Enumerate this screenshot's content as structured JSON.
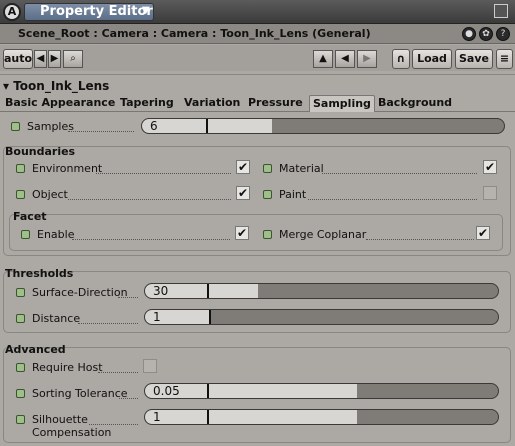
{
  "window": {
    "logo": "A",
    "title": "Property Editor",
    "dropdown_glyph": "▼"
  },
  "pathbar": {
    "path": "Scene_Root : Camera : Camera : Toon_Ink_Lens (General)"
  },
  "toolbar": {
    "auto_label": "auto",
    "load_label": "Load",
    "save_label": "Save"
  },
  "property": {
    "name": "Toon_Ink_Lens"
  },
  "tabs": [
    {
      "label": "Basic Appearance",
      "active": false
    },
    {
      "label": "Tapering",
      "active": false
    },
    {
      "label": "Variation",
      "active": false
    },
    {
      "label": "Pressure",
      "active": false
    },
    {
      "label": "Sampling",
      "active": true
    },
    {
      "label": "Background",
      "active": false
    }
  ],
  "samples": {
    "label": "Samples",
    "value": "6",
    "level": 0.36
  },
  "boundaries": {
    "title": "Boundaries",
    "environment": {
      "label": "Environment",
      "checked": true
    },
    "material": {
      "label": "Material",
      "checked": true
    },
    "object": {
      "label": "Object",
      "checked": true
    },
    "paint": {
      "label": "Paint",
      "checked": false
    }
  },
  "facet": {
    "title": "Facet",
    "enable": {
      "label": "Enable",
      "checked": true
    },
    "merge_coplanar": {
      "label": "Merge Coplanar",
      "checked": true
    }
  },
  "thresholds": {
    "title": "Thresholds",
    "surface_direction": {
      "label": "Surface-Direction",
      "value": "30",
      "level": 0.32
    },
    "distance": {
      "label": "Distance",
      "value": "1",
      "level": 0.18
    }
  },
  "advanced": {
    "title": "Advanced",
    "require_host": {
      "label": "Require Host",
      "checked": false
    },
    "sorting_tolerance": {
      "label": "Sorting Tolerance",
      "value": "0.05",
      "level": 0.6
    },
    "silhouette_compensation": {
      "label_line1": "Silhouette",
      "label_line2": "Compensation",
      "value": "1",
      "level": 0.6
    }
  },
  "colors": {
    "background": "#aca8a4",
    "led": "#9fbf8a",
    "title_chip": "#6b7d97"
  }
}
